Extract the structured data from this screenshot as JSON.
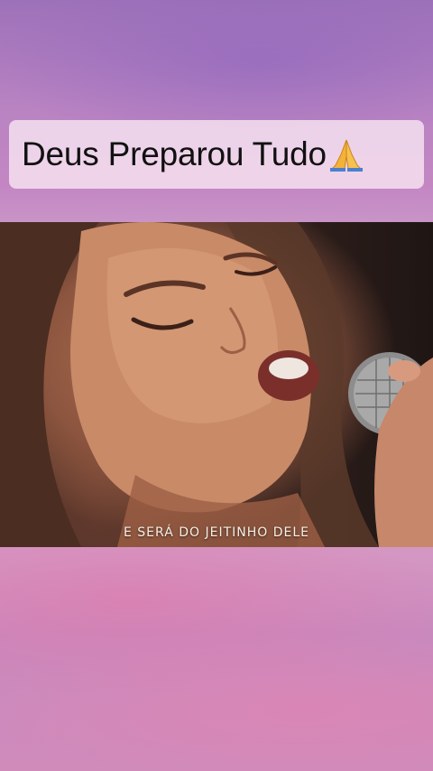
{
  "title_card": {
    "text": "Deus Preparou Tudo",
    "emoji": "🙏",
    "emoji_icon": "praying-hands-icon"
  },
  "video": {
    "subtitle": "E SERÁ DO JEITINHO DELE",
    "content": "singer-with-microphone"
  },
  "colors": {
    "background_top": "#9d71b9",
    "background_bottom": "#d08bbb",
    "card_bg": "#f4deee",
    "title_text": "#111111",
    "subtitle_text": "#f6f0e6"
  }
}
